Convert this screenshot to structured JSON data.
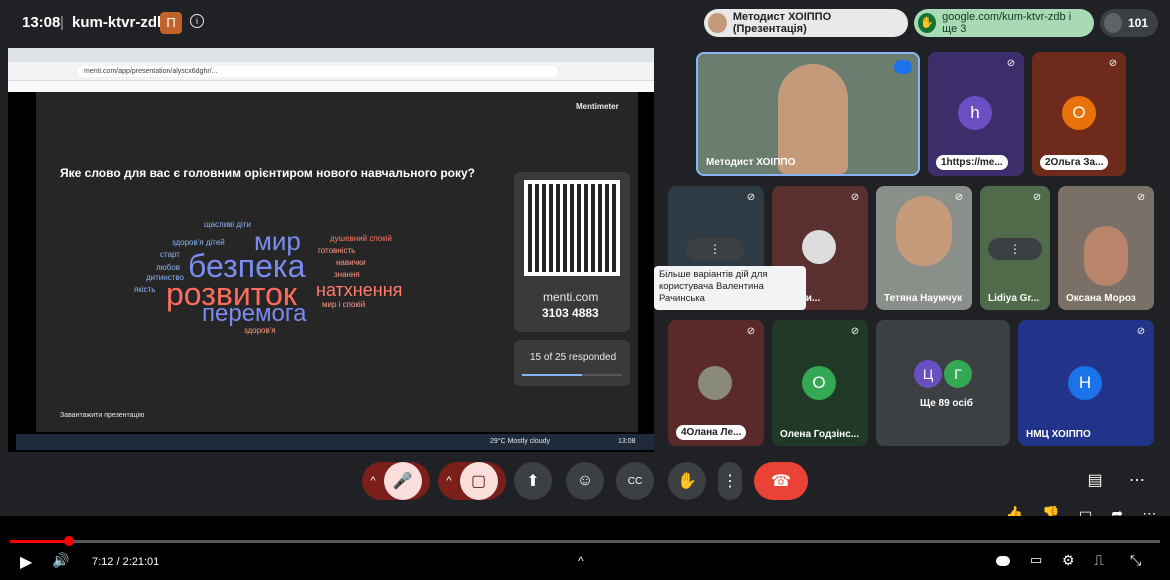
{
  "meeting": {
    "time": "13:08",
    "code": "kum-ktvr-zdb",
    "presenter_badge": "Методист ХОІППО (Презентація)",
    "link_pill": "google.com/kum-ktvr-zdb і ще 3",
    "participants_count": "101"
  },
  "browser": {
    "url": "menti.com/app/presentation/alyscx6dghr/..."
  },
  "slide": {
    "brand": "Mentimeter",
    "question": "Яке слово для вас є головним орієнтиром нового навчального року?",
    "menti_site": "menti.com",
    "code": "3103 4883",
    "responded": "15 of 25 responded",
    "footer_btn": "Завантажити презентацію",
    "words": [
      {
        "text": "щасливі діти",
        "color": "#8ab4f8"
      },
      {
        "text": "мир",
        "color": "#7b8cf0"
      },
      {
        "text": "душевний спокій",
        "color": "#ff7a6b"
      },
      {
        "text": "здоров'я дітей",
        "color": "#8ab4f8"
      },
      {
        "text": "готовність",
        "color": "#ff9a85"
      },
      {
        "text": "старт",
        "color": "#8ab4f8"
      },
      {
        "text": "безпека",
        "color": "#7b8cf0"
      },
      {
        "text": "навички",
        "color": "#ff9a85"
      },
      {
        "text": "любов",
        "color": "#8ab4f8"
      },
      {
        "text": "знання",
        "color": "#ff9a85"
      },
      {
        "text": "дитинство",
        "color": "#8ab4f8"
      },
      {
        "text": "якість",
        "color": "#8ab4f8"
      },
      {
        "text": "розвиток",
        "color": "#ff6b5e"
      },
      {
        "text": "натхнення",
        "color": "#ff7a6b"
      },
      {
        "text": "мир і спокій",
        "color": "#ff9a85"
      },
      {
        "text": "перемога",
        "color": "#7b8cf0"
      },
      {
        "text": "здоров'я",
        "color": "#ff9a85"
      }
    ]
  },
  "taskbar": {
    "weather": "29°C Mostly cloudy",
    "clock": "13:08"
  },
  "tiles": [
    {
      "name": "Методист ХОІППО"
    },
    {
      "name": "1https://me...",
      "avatar": "h",
      "color": "#4285f4"
    },
    {
      "name": "2Ольга За...",
      "avatar": "О",
      "color": "#e8710a"
    },
    {
      "name": "Якими..."
    },
    {
      "name": "Тетяна Наумчук"
    },
    {
      "name": "Lidiya Gr..."
    },
    {
      "name": "Оксана Мороз"
    },
    {
      "name": "4Олана Ле..."
    },
    {
      "name": "Олена Годзінс...",
      "avatar": "О",
      "color": "#34a853"
    },
    {
      "name": "Ще 89 осіб",
      "a1": "Ц",
      "a2": "Г"
    },
    {
      "name": "НМЦ ХОІППО",
      "avatar": "Н",
      "color": "#1a73e8"
    }
  ],
  "tooltip": "Більше варіантів дій для користувача Валентина Рачинська",
  "player": {
    "time": "7:12 / 2:21:01",
    "progress": 0.051
  }
}
